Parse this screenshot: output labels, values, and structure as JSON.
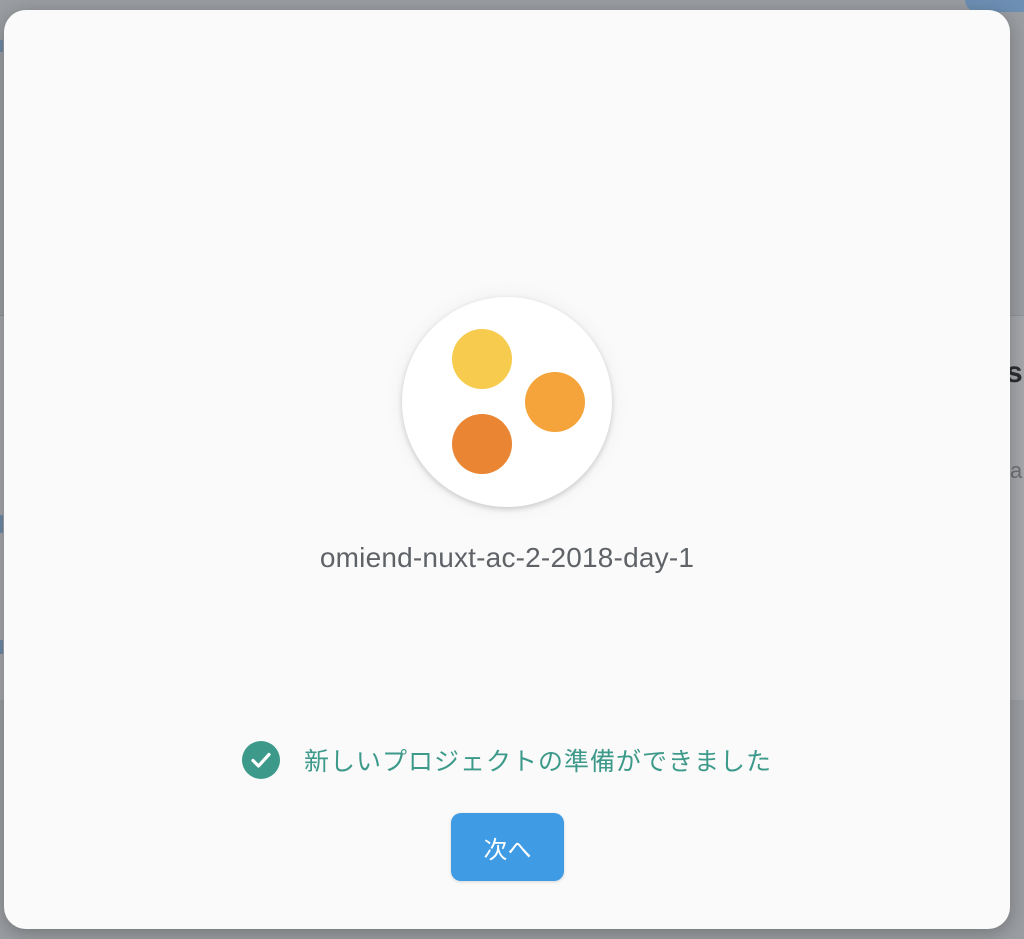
{
  "background": {
    "heading_fragment": "s",
    "subtext_fragment": "a"
  },
  "dialog": {
    "project": {
      "icon": "project-dots-icon",
      "dot_colors": [
        "#f7cb4d",
        "#f4a43a",
        "#ea8533"
      ],
      "name": "omiend-nuxt-ac-2-2018-day-1"
    },
    "status": {
      "icon": "check-circle-icon",
      "text": "新しいプロジェクトの準備ができました",
      "color": "#3d9a8a"
    },
    "next_button": {
      "label": "次へ",
      "color": "#3f9be4"
    }
  }
}
